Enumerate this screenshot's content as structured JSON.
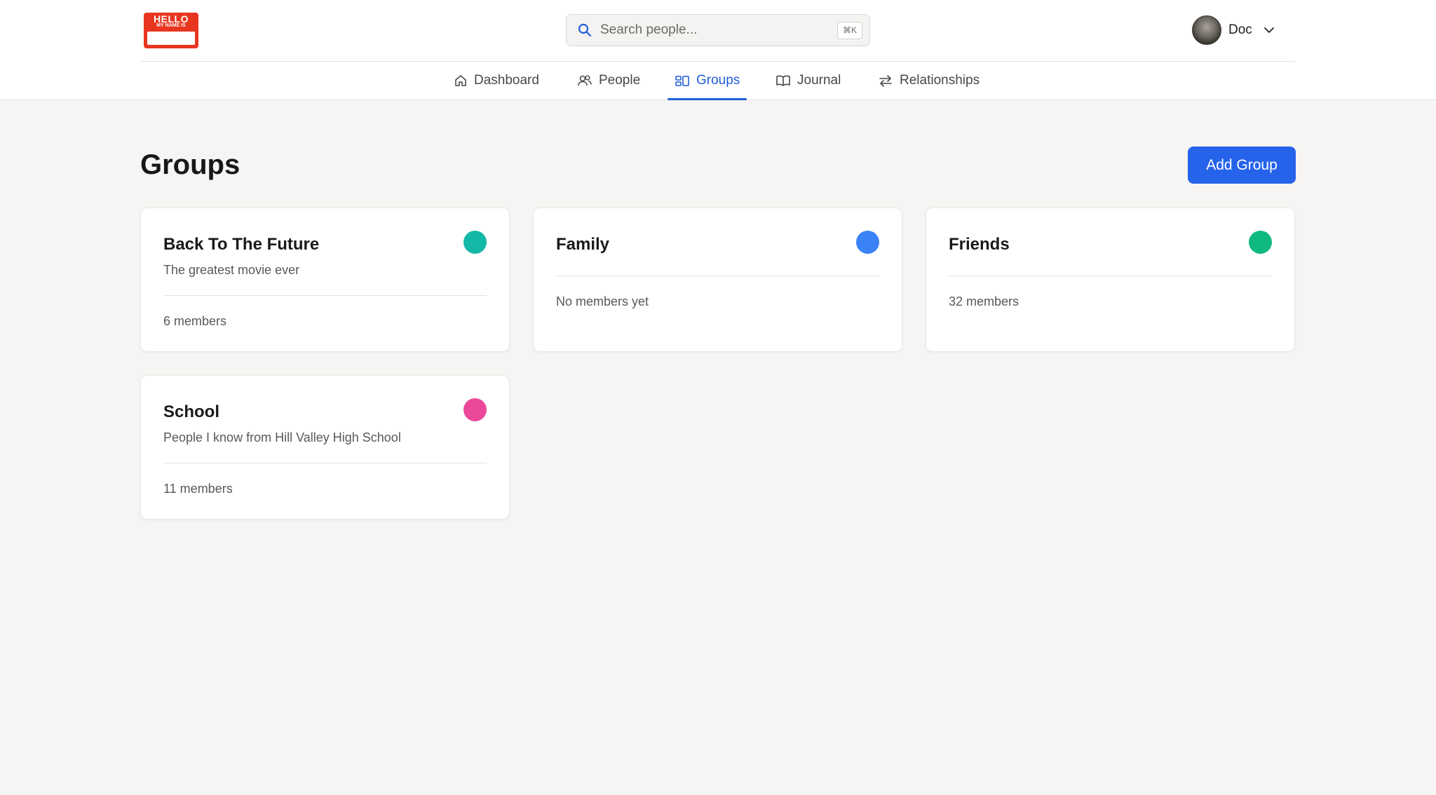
{
  "logo": {
    "line1": "HELLO",
    "line2": "MY NAME IS"
  },
  "search": {
    "placeholder": "Search people...",
    "shortcut": "⌘K"
  },
  "user": {
    "name": "Doc"
  },
  "nav": [
    {
      "label": "Dashboard",
      "icon": "home-icon"
    },
    {
      "label": "People",
      "icon": "users-icon"
    },
    {
      "label": "Groups",
      "icon": "groups-icon",
      "active": true
    },
    {
      "label": "Journal",
      "icon": "book-icon"
    },
    {
      "label": "Relationships",
      "icon": "arrows-icon"
    }
  ],
  "page": {
    "title": "Groups",
    "add_button": "Add Group"
  },
  "groups": [
    {
      "name": "Back To The Future",
      "description": "The greatest movie ever",
      "members": "6 members",
      "color": "#14b8a6"
    },
    {
      "name": "Family",
      "description": "",
      "members": "No members yet",
      "color": "#3b82f6"
    },
    {
      "name": "Friends",
      "description": "",
      "members": "32 members",
      "color": "#10b981"
    },
    {
      "name": "School",
      "description": "People I know from Hill Valley High School",
      "members": "11 members",
      "color": "#ec4899"
    }
  ],
  "colors": {
    "accent": "#2563eb",
    "background": "#f6f5f3"
  }
}
